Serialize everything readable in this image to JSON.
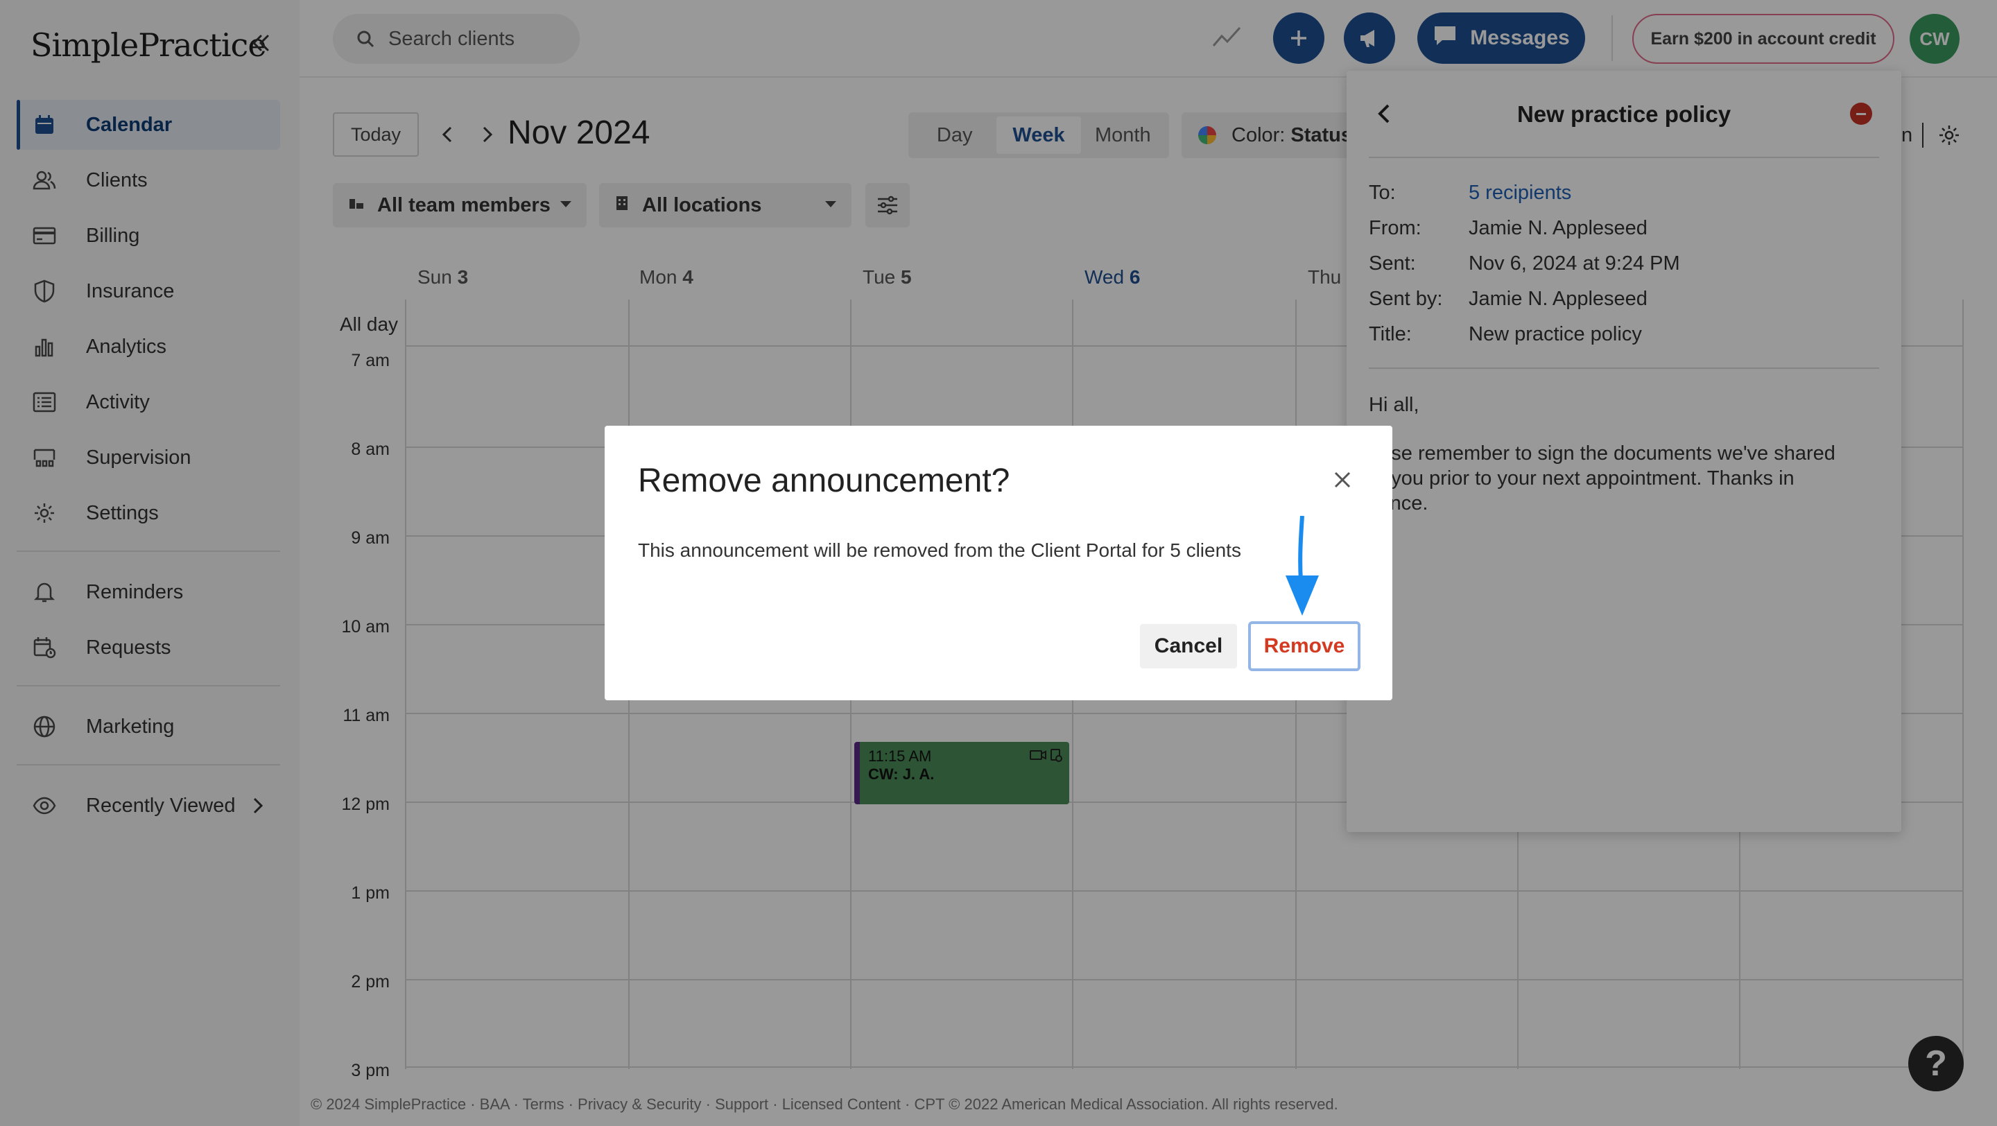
{
  "app": {
    "brand": "SimplePractice"
  },
  "sidebar": {
    "items": [
      {
        "label": "Calendar",
        "icon": "calendar-icon",
        "active": true
      },
      {
        "label": "Clients",
        "icon": "clients-icon"
      },
      {
        "label": "Billing",
        "icon": "credit-card-icon"
      },
      {
        "label": "Insurance",
        "icon": "shield-icon"
      },
      {
        "label": "Analytics",
        "icon": "bar-chart-icon"
      },
      {
        "label": "Activity",
        "icon": "list-icon"
      },
      {
        "label": "Supervision",
        "icon": "supervision-icon"
      },
      {
        "label": "Settings",
        "icon": "gear-icon"
      }
    ],
    "secondary": [
      {
        "label": "Reminders",
        "icon": "bell-icon"
      },
      {
        "label": "Requests",
        "icon": "calendar-request-icon"
      }
    ],
    "tertiary": [
      {
        "label": "Marketing",
        "icon": "globe-icon"
      }
    ],
    "recently_viewed": {
      "label": "Recently Viewed",
      "icon": "eye-icon"
    }
  },
  "topbar": {
    "search_placeholder": "Search clients",
    "messages_label": "Messages",
    "credit_label": "Earn $200 in account credit",
    "avatar_initials": "CW"
  },
  "calendar": {
    "today_label": "Today",
    "month_label": "Nov 2024",
    "views": [
      "Day",
      "Week",
      "Month"
    ],
    "selected_view": "Week",
    "color_label": "Color: ",
    "color_value": "Status",
    "team_filter": "All team members",
    "location_filter": "All locations",
    "days": [
      {
        "name": "Sun",
        "num": "3"
      },
      {
        "name": "Mon",
        "num": "4"
      },
      {
        "name": "Tue",
        "num": "5"
      },
      {
        "name": "Wed",
        "num": "6",
        "today": true
      },
      {
        "name": "Thu",
        "num": ""
      }
    ],
    "all_day_label": "All day",
    "times": [
      "7 am",
      "8 am",
      "9 am",
      "10 am",
      "11 am",
      "12 pm",
      "1 pm",
      "2 pm",
      "3 pm"
    ],
    "event": {
      "time": "11:15 AM",
      "title": "CW: J. A."
    },
    "panel_extra_tail": "n"
  },
  "panel": {
    "title": "New practice policy",
    "to_label": "To:",
    "to_value": "5 recipients",
    "from_label": "From:",
    "from_value": "Jamie N. Appleseed",
    "sent_label": "Sent:",
    "sent_value": "Nov 6, 2024 at 9:24 PM",
    "sentby_label": "Sent by:",
    "sentby_value": "Jamie N. Appleseed",
    "title_label": "Title:",
    "title_value": "New practice policy",
    "greeting": "Hi all,",
    "body": "ease remember to sign the documents we've shared\nth you prior to your next appointment. Thanks in\nvance."
  },
  "modal": {
    "title": "Remove announcement?",
    "message": "This announcement will be removed from the Client Portal for 5 clients",
    "cancel_label": "Cancel",
    "remove_label": "Remove"
  },
  "footer": {
    "text": "© 2024 SimplePractice · BAA · Terms · Privacy & Security · Support · Licensed Content · CPT © 2022 American Medical Association. All rights reserved."
  },
  "colors": {
    "brand": "#1d4f91",
    "danger": "#d33a22",
    "event": "#4b8d59",
    "avatar": "#3a9a5f"
  }
}
